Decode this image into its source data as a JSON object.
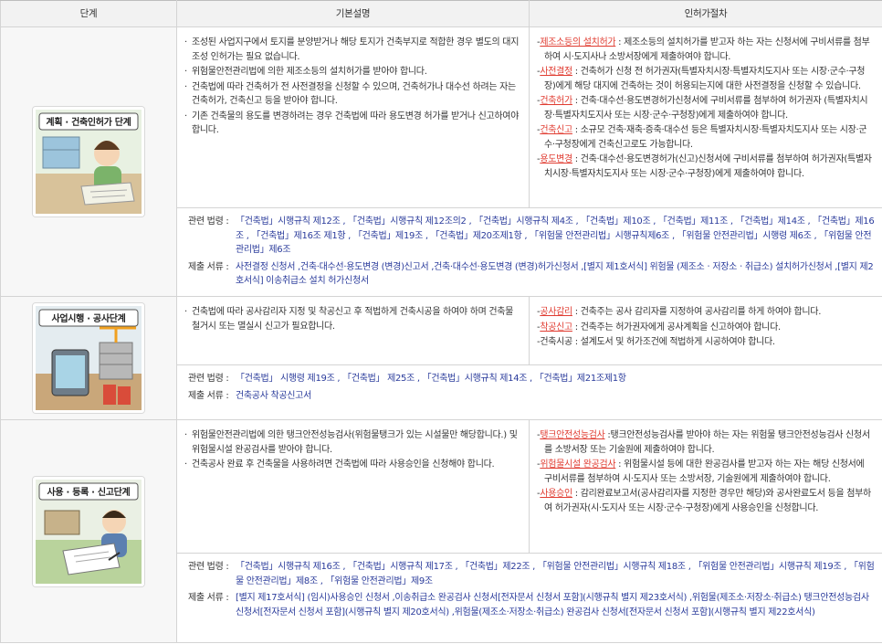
{
  "header": {
    "col1": "단계",
    "col2": "기본설명",
    "col3": "인허가절차"
  },
  "stages": [
    {
      "label": "계획 · 건축인허가 단계",
      "desc": [
        "조성된 사업지구에서 토지를 분양받거나 해당 토지가 건축부지로 적합한 경우 별도의 대지조성 인허가는 필요 없습니다.",
        "위험물안전관리법에 의한 제조소등의 설치허가를 받아야 합니다.",
        "건축법에 따라 건축허가 전 사전결정을 신청할 수 있으며, 건축허가나 대수선 하려는 자는 건축허가, 건축신고 등을 받아야 합니다.",
        "기존 건축물의 용도를 변경하려는 경우 건축법에 따라 용도변경 허가를 받거나 신고하여야 합니다."
      ],
      "proc": [
        {
          "key": "제조소등의 설치허가",
          "text": " : 제조소등의 설치허가를 받고자 하는 자는 신청서에 구비서류를 첨부하여 시·도지사나 소방서장에게 제출하여야 합니다."
        },
        {
          "key": "사전결정",
          "text": " : 건축허가 신청 전 허가권자(특별자치시장·특별자치도지사 또는 시장·군수·구청장)에게 해당 대지에 건축하는 것이 허용되는지에 대한 사전결정을 신청할 수 있습니다."
        },
        {
          "key": "건축허가",
          "text": " : 건축·대수선·용도변경허가신청서에 구비서류를 첨부하여 허가권자 (특별자치시장·특별자치도지사 또는 시장·군수·구청장)에게 제출하여야 합니다."
        },
        {
          "key": "건축신고",
          "text": " : 소규모 건축·재축·증축·대수선 등은 특별자치시장·특별자치도지사 또는 시장·군수·구청장에게 건축신고로도 가능합니다."
        },
        {
          "key": "용도변경",
          "text": " : 건축·대수선·용도변경허가(신고)신청서에 구비서류를 첨부하여 허가권자(특별자치시장·특별자치도지사 또는 시장·군수·구청장)에게 제출하여야 합니다."
        }
      ],
      "laws_label": "관련 법령 :",
      "laws": "「건축법」시행규칙 제12조 , 「건축법」시행규칙 제12조의2 , 「건축법」시행규칙 제4조 , 「건축법」제10조 , 「건축법」제11조 , 「건축법」제14조 , 「건축법」제16조 , 「건축법」제16조 제1항 , 「건축법」제19조 , 「건축법」제20조제1항 , 「위험물 안전관리법」시행규칙제6조 , 「위험물 안전관리법」시행령 제6조 , 「위험물 안전관리법」제6조",
      "docs_label": "제출 서류 :",
      "docs": "사전결정 신청서 ,건축·대수선·용도변경 (변경)신고서 ,건축·대수선·용도변경 (변경)허가신청서 ,[별지 제1호서식] 위험물 (제조소ㆍ저장소ㆍ취급소) 설치허가신청서 ,[별지 제2호서식] 이송취급소 설치 허가신청서"
    },
    {
      "label": "사업시행 · 공사단계",
      "desc": [
        "건축법에 따라 공사감리자 지정 및 착공신고 후 적법하게 건축시공을 하여야 하며 건축물 철거시 또는 멸실시 신고가 필요합니다."
      ],
      "proc": [
        {
          "key": "공사감리",
          "text": " : 건축주는 공사 감리자를 지정하여 공사감리를 하게 하여야 합니다."
        },
        {
          "key": "착공신고",
          "text": " : 건축주는 허가권자에게 공사계획을 신고하여야 합니다."
        },
        {
          "key": "",
          "text": "건축시공 : 설계도서 및 허가조건에 적법하게 시공하여야 합니다."
        }
      ],
      "laws_label": "관련 법령 :",
      "laws": "「건축법」 시행령 제19조 , 「건축법」 제25조 , 「건축법」시행규칙 제14조 , 「건축법」제21조제1항",
      "docs_label": "제출 서류 :",
      "docs": "건축공사 착공신고서"
    },
    {
      "label": "사용 · 등록 · 신고단계",
      "desc": [
        "위험물안전관리법에 의한 탱크안전성능검사(위험물탱크가 있는 시설물만 해당합니다.) 및 위험물시설 완공검사를 받아야 합니다.",
        "건축공사 완료 후 건축물을 사용하려면 건축법에 따라 사용승인을 신청해야 합니다."
      ],
      "proc": [
        {
          "key": "탱크안전성능검사",
          "text": " :탱크안전성능검사를 받아야 하는 자는 위험물 탱크안전성능검사 신청서를 소방서장 또는 기술원에 제출하여야 합니다."
        },
        {
          "key": "위험물시설 완공검사",
          "text": " : 위험물시설 등에 대한 완공검사를 받고자 하는 자는 해당 신청서에 구비서류를 첨부하여 시·도지사 또는 소방서장, 기술원에게 제출하여야 합니다."
        },
        {
          "key": "사용승인",
          "text": " : 감리완료보고서(공사감리자를 지정한 경우만 해당)와 공사완료도서 등을 첨부하여 허가권자(시·도지사 또는 시장·군수·구청장)에게 사용승인을 신청합니다."
        }
      ],
      "laws_label": "관련 법령 :",
      "laws": "「건축법」시행규칙 제16조 , 「건축법」시행규칙 제17조 , 「건축법」제22조 , 「위험물 안전관리법」시행규칙 제18조 , 「위험물 안전관리법」시행규칙 제19조 , 「위험물 안전관리법」제8조 , 「위험물 안전관리법」제9조",
      "docs_label": "제출 서류 :",
      "docs": "[별지 제17호서식] (임시)사용승인 신청서 ,이송취급소 완공검사 신청서[전자문서 신청서 포함](시행규칙 별지 제23호서식) ,위험물(제조소·저장소·취급소) 탱크안전성능검사 신청서[전자문서 신청서 포함](시행규칙 별지 제20호서식) ,위험물(제조소·저장소·취급소) 완공검사 신청서[전자문서 신청서 포함](시행규칙 별지 제22호서식)"
    }
  ]
}
